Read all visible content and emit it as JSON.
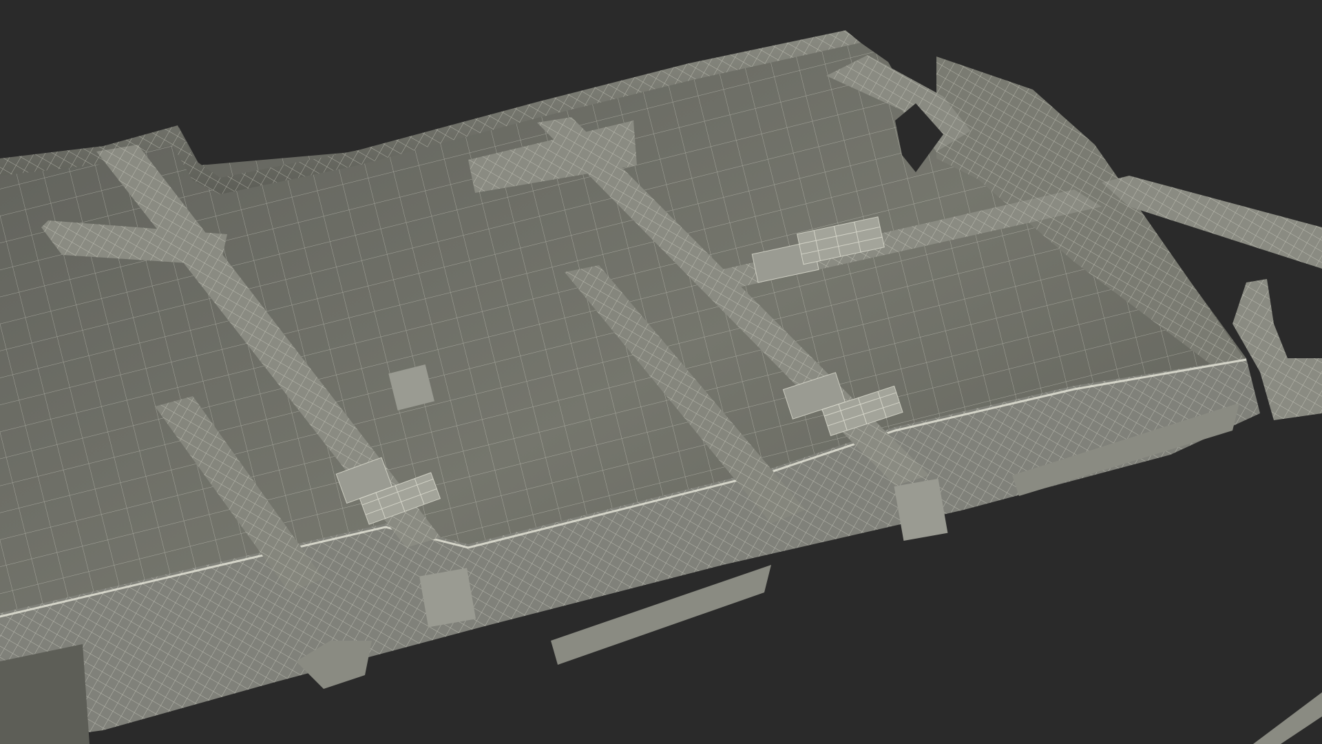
{
  "scene": {
    "background_color": "#2a2a2a",
    "surface_color": "#6b6c64",
    "surface_light_color": "#7d7e75",
    "surface_shadow_color": "#4f504a",
    "wire_color": "#e8e8dc",
    "wire_opacity": 0.55,
    "strap_color": "#8a8b82",
    "buckle_color": "#9a9b92"
  }
}
